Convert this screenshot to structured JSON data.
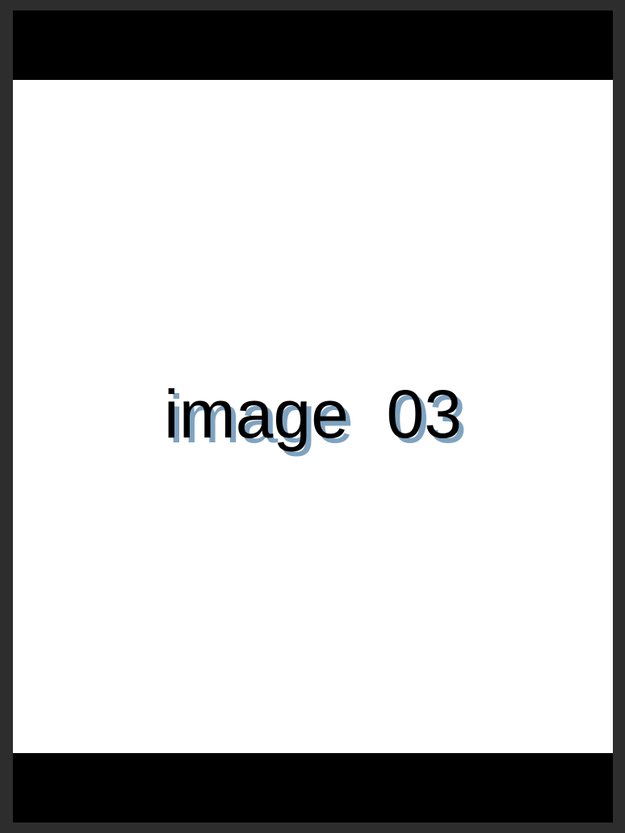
{
  "viewer": {
    "image_label": "image  03"
  },
  "colors": {
    "outer_frame": "#2d2d2d",
    "letterbox": "#000000",
    "image_background": "#ffffff",
    "text": "#000000",
    "text_shadow": "#7fa3c0"
  }
}
